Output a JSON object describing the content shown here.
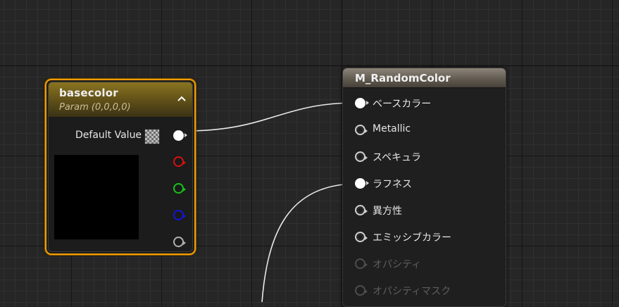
{
  "param_node": {
    "title": "basecolor",
    "subtitle": "Param (0,0,0,0)",
    "default_value_label": "Default Value",
    "collapse_icon": "chevron-up-icon",
    "border_color": "#f39c00",
    "preview_color": "#000000",
    "output_pins": [
      {
        "name": "rgba",
        "color": "#ffffff"
      },
      {
        "name": "r",
        "color": "#d81010"
      },
      {
        "name": "g",
        "color": "#18c018"
      },
      {
        "name": "b",
        "color": "#1515d8"
      },
      {
        "name": "a",
        "color": "#b0b0b0"
      }
    ]
  },
  "material_node": {
    "title": "M_RandomColor",
    "inputs": [
      {
        "label": "ベースカラー",
        "connected": true,
        "enabled": true
      },
      {
        "label": "Metallic",
        "connected": false,
        "enabled": true
      },
      {
        "label": "スペキュラ",
        "connected": false,
        "enabled": true
      },
      {
        "label": "ラフネス",
        "connected": true,
        "enabled": true
      },
      {
        "label": "異方性",
        "connected": false,
        "enabled": true
      },
      {
        "label": "エミッシブカラー",
        "connected": false,
        "enabled": true
      },
      {
        "label": "オパシティ",
        "connected": false,
        "enabled": false
      },
      {
        "label": "オパシティマスク",
        "connected": false,
        "enabled": false
      }
    ]
  },
  "wire_color": "#e8e8e8",
  "graph_background": "#262626"
}
